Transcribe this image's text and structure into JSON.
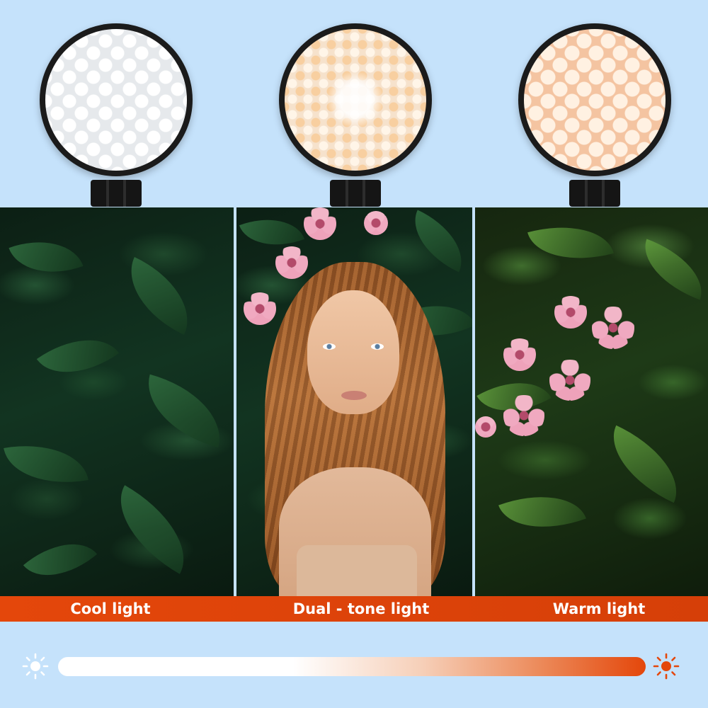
{
  "labels": {
    "cool": "Cool light",
    "dual": "Dual - tone light",
    "warm": "Warm light"
  },
  "panels": [
    {
      "mode": "cool",
      "light_color": "#e6e9ec"
    },
    {
      "mode": "dual",
      "light_color": "#f6e2cc"
    },
    {
      "mode": "warm",
      "light_color": "#f4c4a1"
    }
  ],
  "colors": {
    "background": "#c5e2fb",
    "label_bar": "#e4470b",
    "label_text": "#ffffff",
    "cool_icon": "#ffffff",
    "warm_icon": "#e4470b"
  },
  "icons": {
    "left": "sun-cool-icon",
    "right": "sun-warm-icon"
  }
}
